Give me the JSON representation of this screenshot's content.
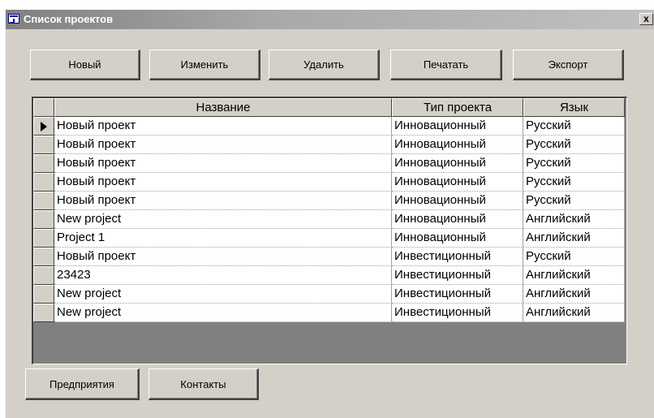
{
  "window": {
    "title": "Список проектов",
    "close_label": "x"
  },
  "toolbar": {
    "buttons": [
      {
        "name": "new-button",
        "label": "Новый"
      },
      {
        "name": "edit-button",
        "label": "Изменить"
      },
      {
        "name": "delete-button",
        "label": "Удалить"
      },
      {
        "name": "print-button",
        "label": "Печатать"
      },
      {
        "name": "export-button",
        "label": "Экспорт"
      }
    ]
  },
  "table": {
    "headers": [
      "Название",
      "Тип проекта",
      "Язык"
    ],
    "current_row": 0,
    "rows": [
      [
        "Новый проект",
        "Инновационный",
        "Русский"
      ],
      [
        "Новый проект",
        "Инновационный",
        "Русский"
      ],
      [
        "Новый проект",
        "Инновационный",
        "Русский"
      ],
      [
        "Новый проект",
        "Инновационный",
        "Русский"
      ],
      [
        "Новый проект",
        "Инновационный",
        "Русский"
      ],
      [
        "New project",
        "Инновационный",
        "Английский"
      ],
      [
        "Project 1",
        "Инновационный",
        "Английский"
      ],
      [
        "Новый проект",
        "Инвестиционный",
        "Русский"
      ],
      [
        "23423",
        "Инвестиционный",
        "Английский"
      ],
      [
        "New project",
        "Инвестиционный",
        "Английский"
      ],
      [
        "New project",
        "Инвестиционный",
        "Английский"
      ]
    ]
  },
  "footer": {
    "buttons": [
      {
        "name": "enterprises-button",
        "label": "Предприятия"
      },
      {
        "name": "contacts-button",
        "label": "Контакты"
      }
    ]
  },
  "colors": {
    "window_bg": "#d4d0c8",
    "grid_bg": "#808080",
    "title_text": "#ffffff"
  }
}
